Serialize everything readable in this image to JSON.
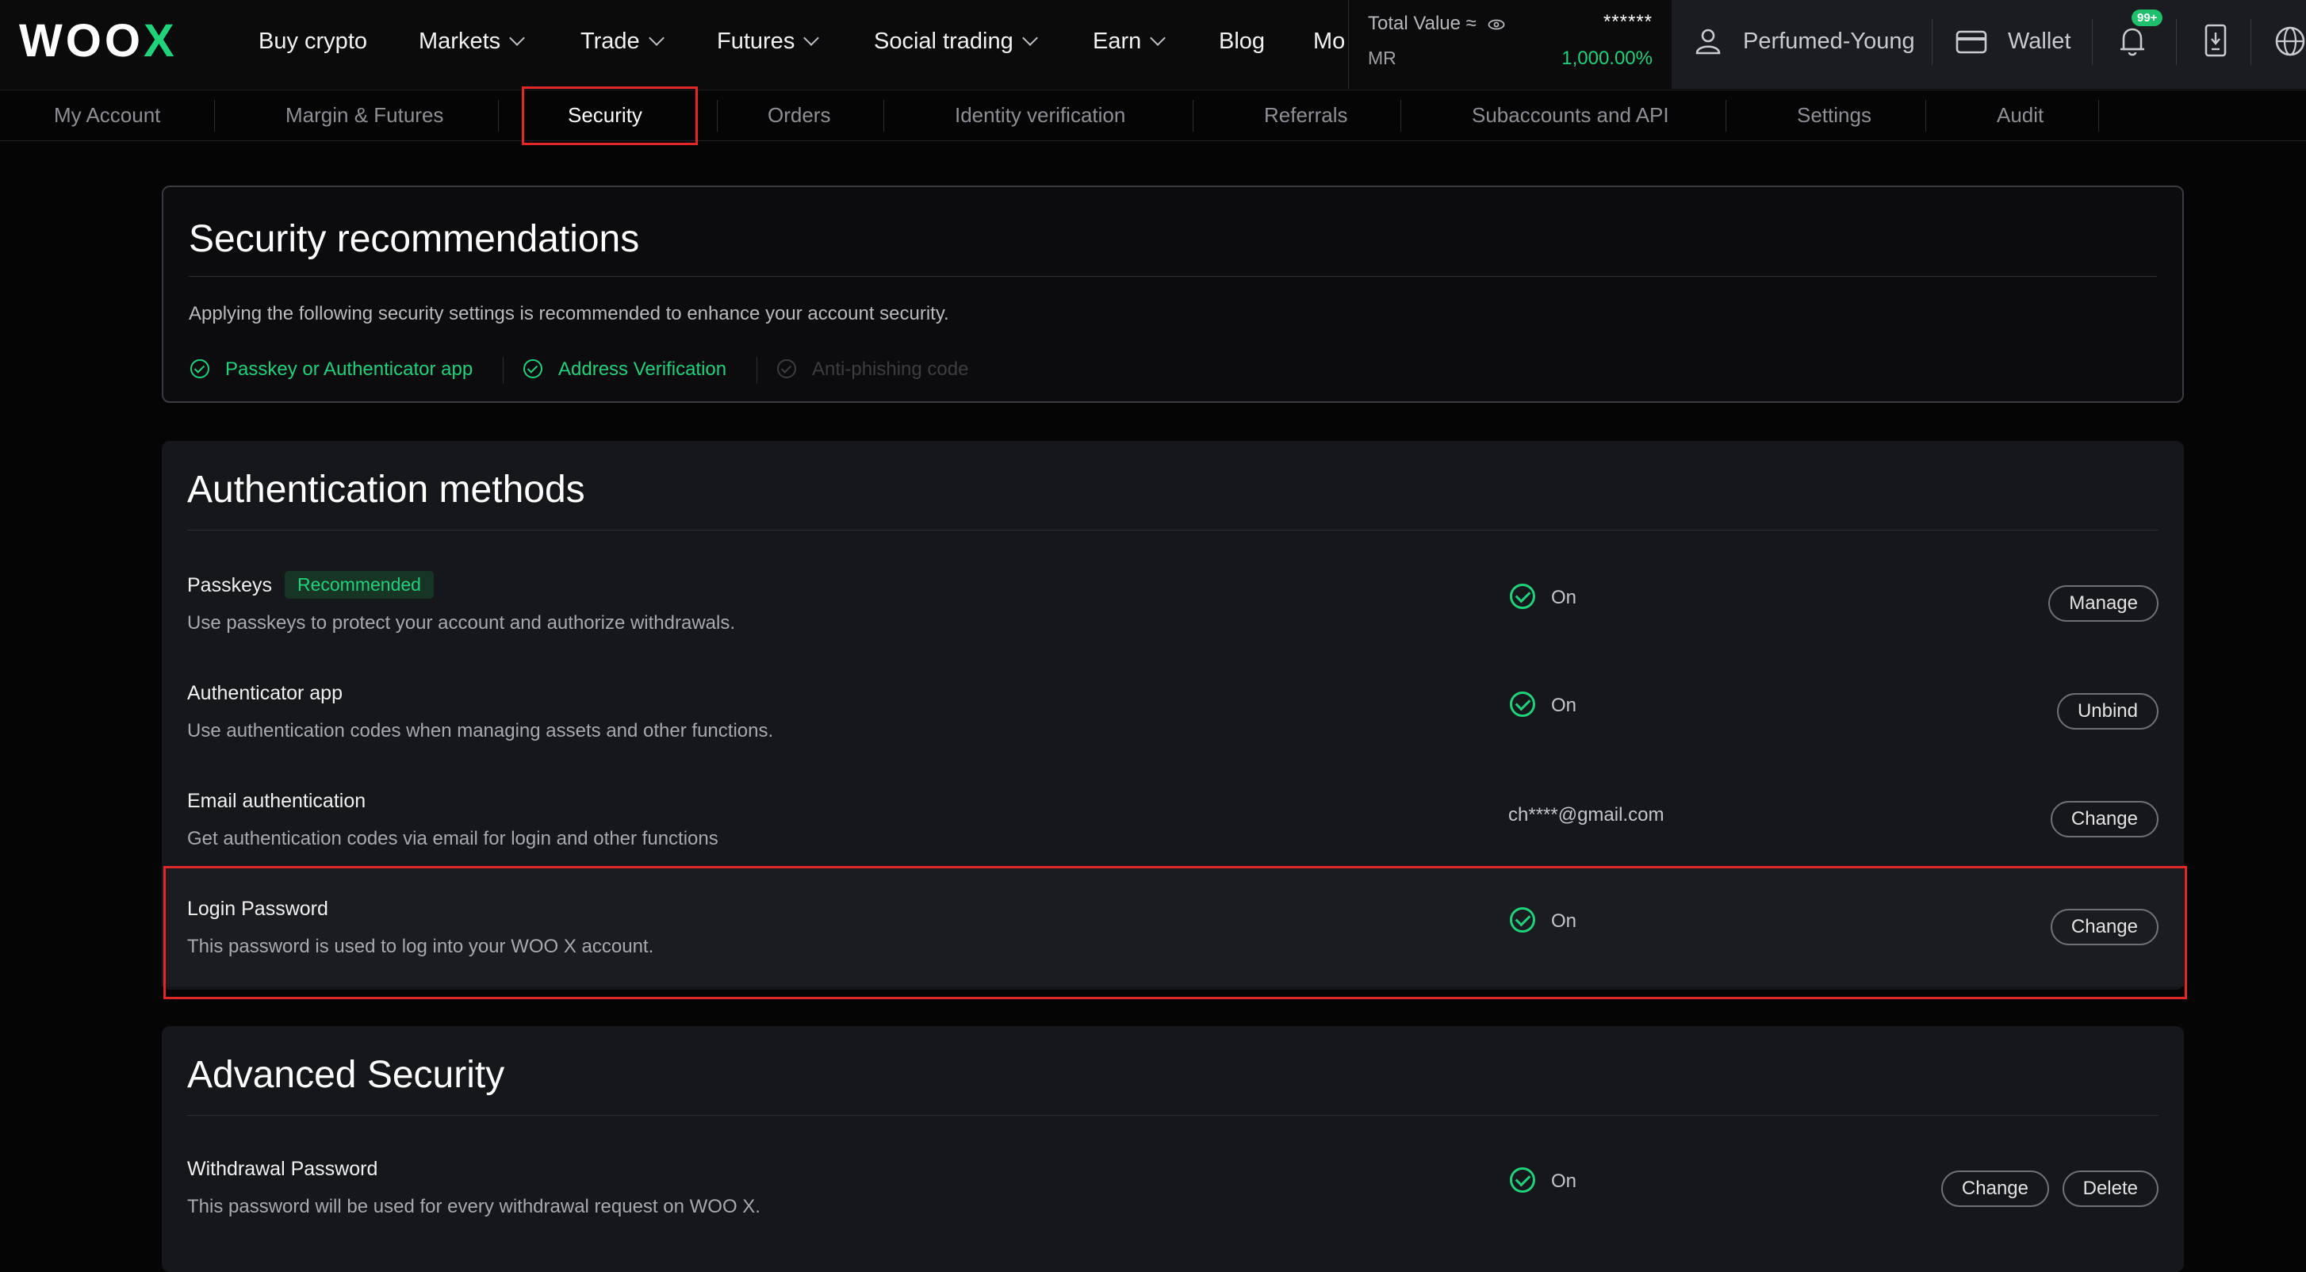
{
  "header": {
    "logo_text": "WOO",
    "logo_x": "X",
    "nav": [
      "Buy crypto",
      "Markets",
      "Trade",
      "Futures",
      "Social trading",
      "Earn",
      "Blog",
      "Mo"
    ],
    "total_value_label": "Total Value ≈",
    "total_value_hidden": "******",
    "mr_label": "MR",
    "mr_value": "1,000.00%",
    "username": "Perfumed-Young",
    "wallet_label": "Wallet",
    "notification_badge": "99+"
  },
  "subnav": {
    "tabs": [
      "My Account",
      "Margin & Futures",
      "Security",
      "Orders",
      "Identity verification",
      "Referrals",
      "Subaccounts and API",
      "Settings",
      "Audit"
    ],
    "active": "Security"
  },
  "recommendations": {
    "title": "Security recommendations",
    "description": "Applying the following security settings is recommended to enhance your account security.",
    "items": [
      {
        "label": "Passkey or Authenticator app",
        "done": true
      },
      {
        "label": "Address Verification",
        "done": true
      },
      {
        "label": "Anti-phishing code",
        "done": false
      }
    ]
  },
  "auth": {
    "title": "Authentication methods",
    "rows": [
      {
        "title": "Passkeys",
        "badge": "Recommended",
        "desc": "Use passkeys to protect your account and authorize withdrawals.",
        "status": "On",
        "button": "Manage"
      },
      {
        "title": "Authenticator app",
        "desc": "Use authentication codes when managing assets and other functions.",
        "status": "On",
        "button": "Unbind"
      },
      {
        "title": "Email authentication",
        "desc": "Get authentication codes via email for login and other functions",
        "value": "ch****@gmail.com",
        "button": "Change"
      },
      {
        "title": "Login Password",
        "desc": "This password is used to log into your WOO X account.",
        "status": "On",
        "button": "Change"
      }
    ]
  },
  "advanced": {
    "title": "Advanced Security",
    "rows": [
      {
        "title": "Withdrawal Password",
        "desc": "This password will be used for every withdrawal request on WOO X.",
        "status": "On",
        "buttons": [
          "Change",
          "Delete"
        ]
      }
    ]
  },
  "colors": {
    "accent_green": "#22d07c",
    "highlight_red": "#e0282b",
    "background": "#050505",
    "card": "#16171a"
  }
}
